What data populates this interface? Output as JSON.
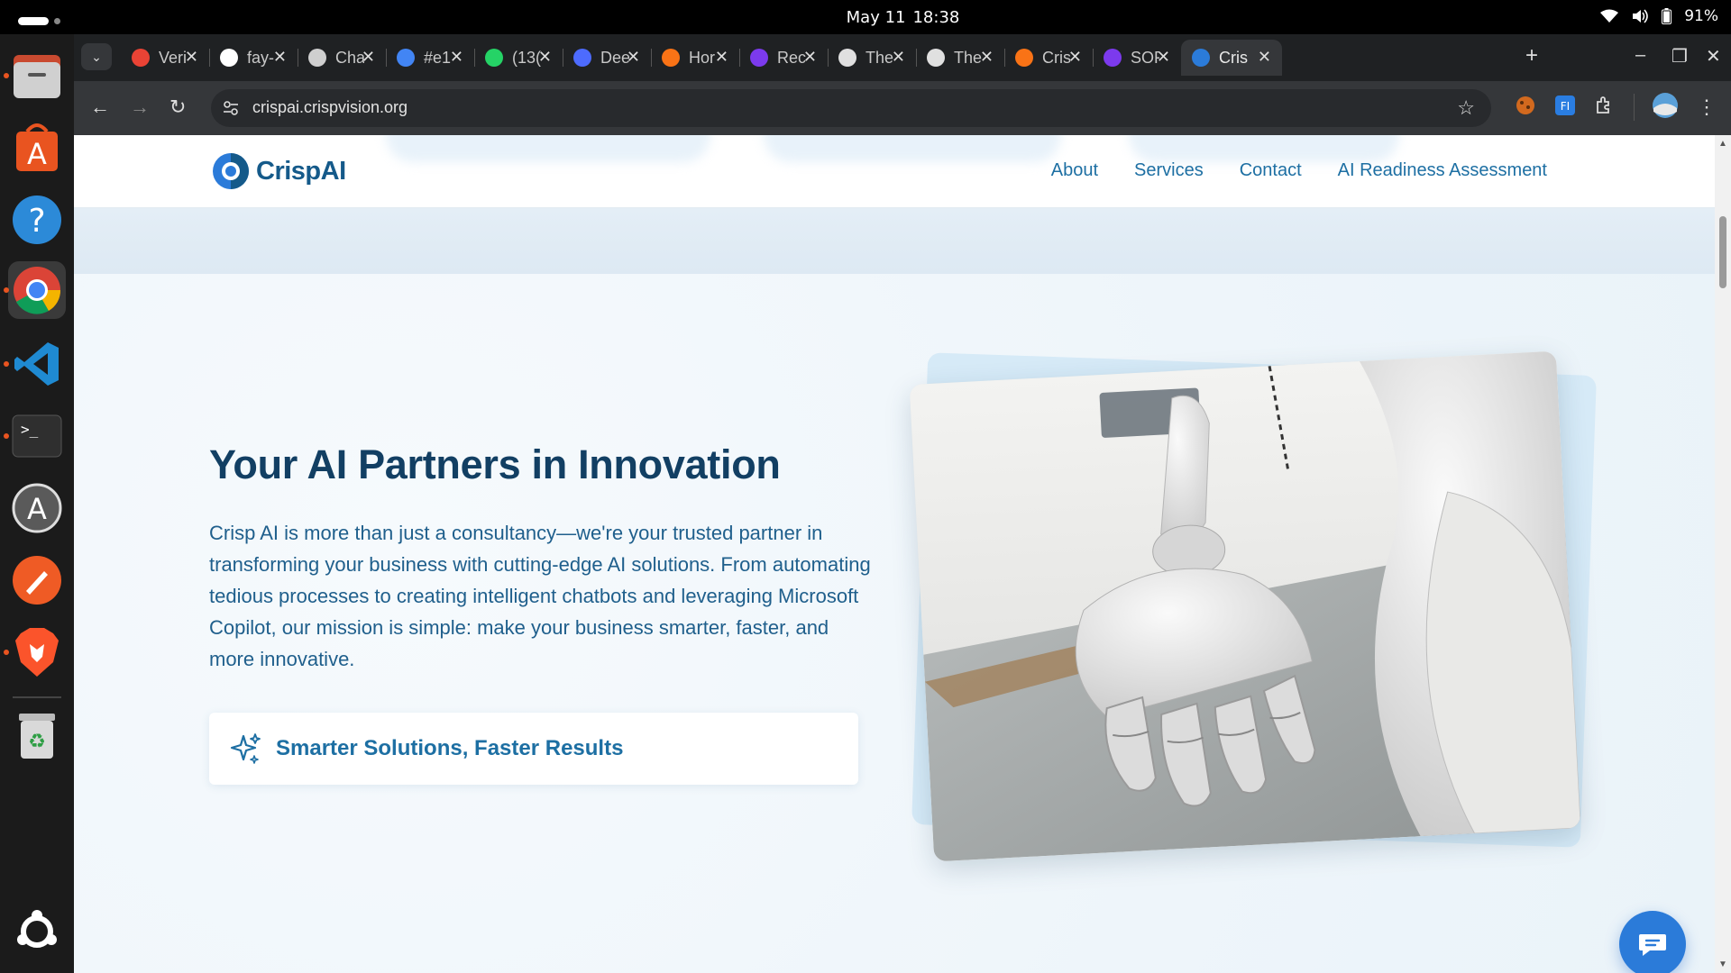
{
  "system": {
    "date": "May 11",
    "time": "18:38",
    "battery": "91%"
  },
  "dock": {
    "apps": [
      "files",
      "app-center",
      "help",
      "chrome",
      "vscode",
      "terminal",
      "software-updater",
      "postman",
      "brave",
      "trash",
      "show-apps"
    ]
  },
  "browser": {
    "tabs": [
      {
        "title": "Veri",
        "icon": "gmail-icon",
        "color": "#ea4335"
      },
      {
        "title": "fay-",
        "icon": "github-icon",
        "color": "#ffffff"
      },
      {
        "title": "Cha",
        "icon": "chatgpt-icon",
        "color": "#cfcfcf"
      },
      {
        "title": "#e1",
        "icon": "google-icon",
        "color": "#4285f4"
      },
      {
        "title": "(13(",
        "icon": "whatsapp-icon",
        "color": "#25d366"
      },
      {
        "title": "Dee",
        "icon": "deepseek-icon",
        "color": "#4d6bfe"
      },
      {
        "title": "Hor",
        "icon": "app-icon",
        "color": "#f97316"
      },
      {
        "title": "Rec",
        "icon": "app-icon",
        "color": "#7c3aed"
      },
      {
        "title": "The",
        "icon": "chat-bubble-icon",
        "color": "#e0e0e0"
      },
      {
        "title": "The",
        "icon": "chat-bubble-icon",
        "color": "#e0e0e0"
      },
      {
        "title": "Cris",
        "icon": "app-icon",
        "color": "#f97316"
      },
      {
        "title": "SOF",
        "icon": "app-icon",
        "color": "#7c3aed"
      },
      {
        "title": "Cris",
        "icon": "crispai-icon",
        "color": "#2b7bd9",
        "active": true
      }
    ],
    "url": "crispai.crispvision.org"
  },
  "site": {
    "brand": "CrispAI",
    "nav": [
      "About",
      "Services",
      "Contact",
      "AI Readiness Assessment"
    ],
    "hero_title": "Your AI Partners in Innovation",
    "hero_text": "Crisp AI is more than just a consultancy—we're your trusted partner in transforming your business with cutting-edge AI solutions. From automating tedious processes to creating intelligent chatbots and leveraging Microsoft Copilot, our mission is simple: make your business smarter, faster, and more innovative.",
    "feature_text": "Smarter Solutions, Faster Results",
    "accent": "#1d6fa3",
    "heading_color": "#123f63"
  }
}
